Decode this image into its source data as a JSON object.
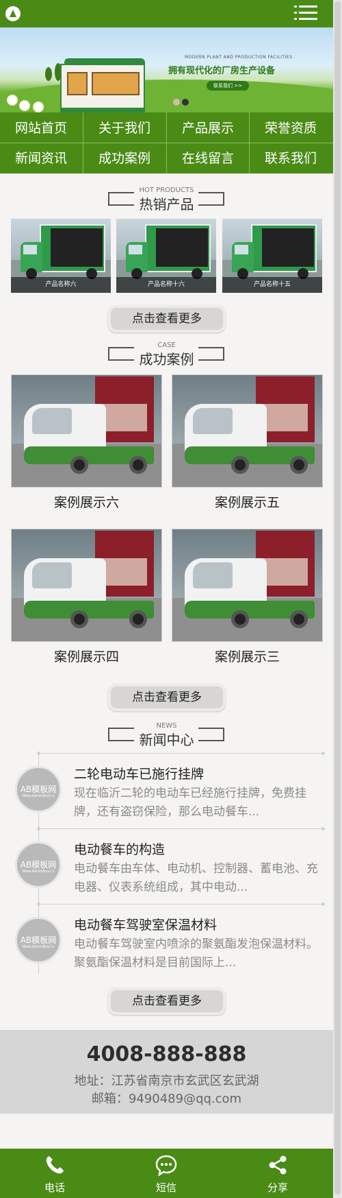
{
  "banner": {
    "subtitle": "MODERN PLANT AND PRODUCTION FACILITIES",
    "headline": "拥有现代化的厂房生产设备",
    "button": "联系我们 >>"
  },
  "nav": {
    "items": [
      "网站首页",
      "关于我们",
      "产品展示",
      "荣誉资质",
      "新闻资讯",
      "成功案例",
      "在线留言",
      "联系我们"
    ]
  },
  "hot_products": {
    "title_en": "HOT PRODUCTS",
    "title_cn": "热销产品",
    "items": [
      "产品名称六",
      "产品名称十六",
      "产品名称十五"
    ],
    "more": "点击查看更多"
  },
  "cases": {
    "title_en": "CASE",
    "title_cn": "成功案例",
    "items": [
      "案例展示六",
      "案例展示五",
      "案例展示四",
      "案例展示三"
    ],
    "more": "点击查看更多"
  },
  "news": {
    "title_en": "NEWS",
    "title_cn": "新闻中心",
    "thumb_text": "AB模板网",
    "thumb_sub": "Www.AdminBuy.Cn",
    "items": [
      {
        "title": "二轮电动车已施行挂牌",
        "desc": "现在临沂二轮的电动车已经施行挂牌，免费挂牌，还有盗窃保险，那么电动餐车..."
      },
      {
        "title": "电动餐车的构造",
        "desc": "电动餐车由车体、电动机、控制器、蓄电池、充电器、仪表系统组成，其中电动..."
      },
      {
        "title": "电动餐车驾驶室保温材料",
        "desc": "电动餐车驾驶室内喷涂的聚氨酯发泡保温材料。 聚氨酯保温材料是目前国际上..."
      }
    ],
    "more": "点击查看更多"
  },
  "contact": {
    "phone": "4008-888-888",
    "address": "地址：江苏省南京市玄武区玄武湖",
    "email": "邮箱：9490489@qq.com"
  },
  "footer": {
    "items": [
      "电话",
      "短信",
      "分享"
    ]
  },
  "colors": {
    "brand_green": "#4a8b16",
    "page_bg": "#f5f4f2",
    "contact_bg": "#d6d6d6"
  }
}
